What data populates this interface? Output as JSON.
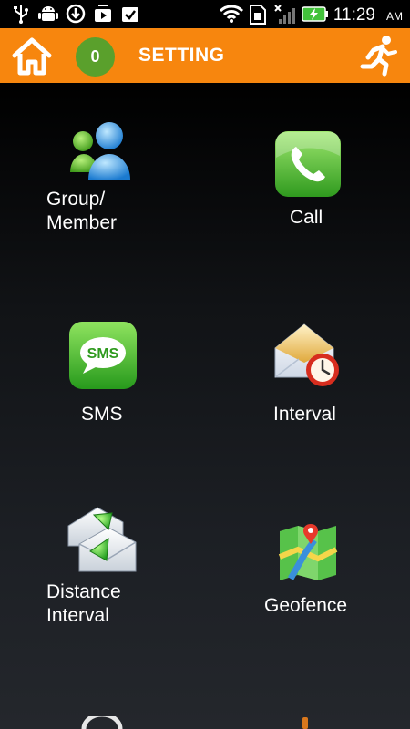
{
  "status_bar": {
    "time": "11:29",
    "ampm": "AM",
    "icons": [
      "usb-icon",
      "android-debug-icon",
      "download-icon",
      "media-icon",
      "check-clipboard-icon",
      "wifi-icon",
      "sim-card-icon",
      "signal-icon",
      "battery-charging-icon"
    ]
  },
  "app_bar": {
    "home_icon": "home-icon",
    "count": "0",
    "title": "SETTING",
    "action_icon": "running-man-icon",
    "color": "#f7860e"
  },
  "menu": {
    "group_member": {
      "label": "Group/\nMember",
      "icon": "group-people-icon"
    },
    "call": {
      "label": "Call",
      "icon": "phone-icon"
    },
    "sms": {
      "label": "SMS",
      "icon": "sms-bubble-icon"
    },
    "interval": {
      "label": "Interval",
      "icon": "envelope-clock-icon"
    },
    "distance_interval": {
      "label": "Distance\nInterval",
      "icon": "envelopes-arrows-icon"
    },
    "geofence": {
      "label": "Geofence",
      "icon": "map-pin-icon"
    }
  }
}
